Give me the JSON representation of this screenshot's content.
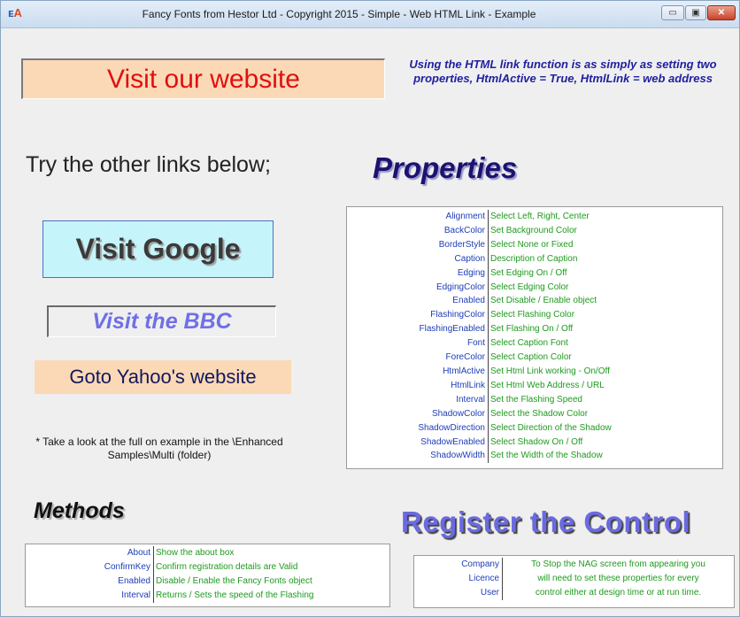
{
  "window": {
    "title": "Fancy Fonts from Hestor Ltd - Copyright 2015 - Simple - Web HTML Link - Example",
    "app_icon": "fancy-fonts-app-icon",
    "controls": {
      "minimize": "▭",
      "maximize": "▣",
      "close": "✕"
    }
  },
  "links": {
    "website": "Visit our website",
    "google": "Visit Google",
    "bbc": "Visit the BBC",
    "yahoo": "Goto Yahoo's website"
  },
  "intro_text": "Using the HTML link function is as simply as setting two properties, HtmlActive = True, HtmlLink = web address",
  "try_text": "Try the other links below;",
  "note_text": "* Take a look at the full on example in the \\Enhanced Samples\\Multi (folder)",
  "properties": {
    "title": "Properties",
    "items": [
      {
        "name": "Alignment",
        "desc": "Select Left, Right, Center"
      },
      {
        "name": "BackColor",
        "desc": "Set Background Color"
      },
      {
        "name": "BorderStyle",
        "desc": "Select None or Fixed"
      },
      {
        "name": "Caption",
        "desc": "Description of Caption"
      },
      {
        "name": "Edging",
        "desc": "Set Edging On / Off"
      },
      {
        "name": "EdgingColor",
        "desc": "Select Edging Color"
      },
      {
        "name": "Enabled",
        "desc": "Set Disable / Enable object"
      },
      {
        "name": "FlashingColor",
        "desc": "Select Flashing Color"
      },
      {
        "name": "FlashingEnabled",
        "desc": "Set Flashing On / Off"
      },
      {
        "name": "Font",
        "desc": "Select Caption Font"
      },
      {
        "name": "ForeColor",
        "desc": "Select Caption Color"
      },
      {
        "name": "HtmlActive",
        "desc": "Set Html Link working - On/Off"
      },
      {
        "name": "HtmlLink",
        "desc": "Set Html Web Address / URL"
      },
      {
        "name": "Interval",
        "desc": "Set the Flashing Speed"
      },
      {
        "name": "ShadowColor",
        "desc": "Select the Shadow Color"
      },
      {
        "name": "ShadowDirection",
        "desc": "Select Direction of the Shadow"
      },
      {
        "name": "ShadowEnabled",
        "desc": "Select Shadow On / Off"
      },
      {
        "name": "ShadowWidth",
        "desc": "Set the Width of the Shadow"
      }
    ]
  },
  "methods": {
    "title": "Methods",
    "items": [
      {
        "name": "About",
        "desc": "Show the about box"
      },
      {
        "name": "ConfirmKey",
        "desc": "Confirm registration details are Valid"
      },
      {
        "name": "Enabled",
        "desc": "Disable / Enable the Fancy Fonts object"
      },
      {
        "name": "Interval",
        "desc": "Returns / Sets the speed of the Flashing"
      }
    ]
  },
  "register": {
    "title": "Register the Control",
    "items": [
      {
        "name": "Company",
        "desc": "To Stop the NAG screen from appearing you"
      },
      {
        "name": "Licence",
        "desc": "will need to set these properties for every"
      },
      {
        "name": "User",
        "desc": "control either at design time or at run time."
      }
    ]
  },
  "colors": {
    "link_red": "#e01010",
    "peach": "#fbd9b6",
    "google_bg": "#c5f5fb",
    "bbc_blue": "#6f6fe8",
    "name_blue": "#1f3db8",
    "desc_green": "#1e9a1e"
  }
}
